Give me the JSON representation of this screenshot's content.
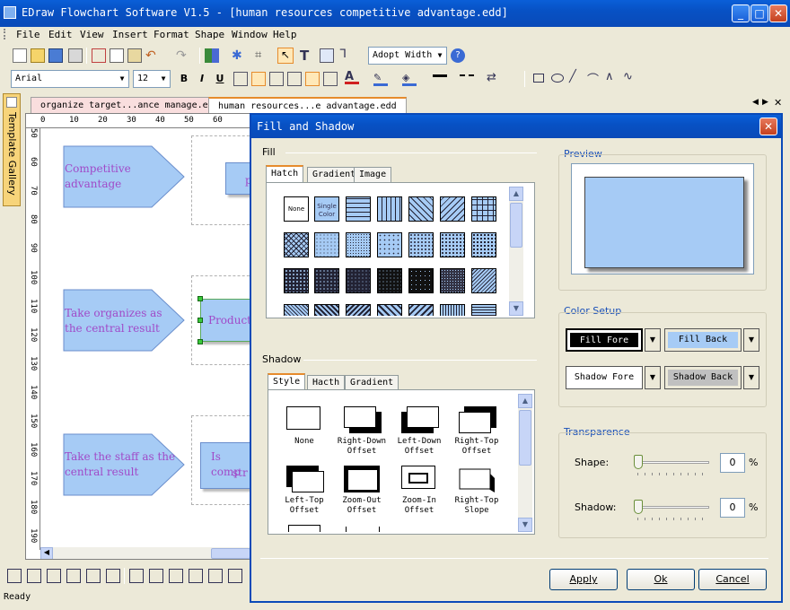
{
  "app": {
    "title": "EDraw Flowchart Software V1.5 - [human resources competitive advantage.edd]",
    "menu": [
      "File",
      "Edit",
      "View",
      "Insert",
      "Format",
      "Shape",
      "Window",
      "Help"
    ],
    "toolbar": {
      "adopt_width": "Adopt Width"
    },
    "format": {
      "font": "Arial",
      "size": "12",
      "bold": "B",
      "italic": "I",
      "underline": "U"
    },
    "gallery_tab": "Template Gallery",
    "doc_tabs": [
      "organize target...ance manage.edd",
      "human resources...e advantage.edd"
    ],
    "ruler_h": [
      "0",
      "10",
      "20",
      "30",
      "40",
      "50",
      "60"
    ],
    "ruler_v": [
      "50",
      "60",
      "70",
      "80",
      "90",
      "100",
      "110",
      "120",
      "130",
      "140",
      "150",
      "160",
      "170",
      "180",
      "190"
    ],
    "shapes": {
      "s1": "Competitive advantage",
      "s1b": "p",
      "s2": "Take organizes as the central result",
      "s2b": "Productio",
      "s3": "Take the staff as the central result",
      "s3b_line1": "Is comp",
      "s3b_line2": "str"
    },
    "status": "Ready"
  },
  "dialog": {
    "title": "Fill and Shadow",
    "fill": {
      "label": "Fill",
      "tabs": [
        "Hatch",
        "Gradient",
        "Image"
      ],
      "none_label": "None",
      "single_color_label": "Single Color"
    },
    "shadow": {
      "label": "Shadow",
      "tabs": [
        "Style",
        "Hacth",
        "Gradient"
      ],
      "items": [
        "None",
        "Right-Down Offset",
        "Left-Down Offset",
        "Right-Top Offset",
        "Left-Top Offset",
        "Zoom-Out Offset",
        "Zoom-In Offset",
        "Right-Top Slope"
      ]
    },
    "preview": {
      "label": "Preview",
      "fill_color": "#a6cbf5"
    },
    "color_setup": {
      "label": "Color Setup",
      "fill_fore": "Fill Fore",
      "fill_back": "Fill Back",
      "shadow_fore": "Shadow Fore",
      "shadow_back": "Shadow Back"
    },
    "transparence": {
      "label": "Transparence",
      "shape_label": "Shape:",
      "shape_value": "0",
      "shadow_label": "Shadow:",
      "shadow_value": "0",
      "unit": "%"
    },
    "buttons": {
      "apply": "Apply",
      "ok": "Ok",
      "cancel": "Cancel"
    }
  },
  "colors": {
    "accent": "#0a4ab8",
    "shape_fill": "#a6cbf5",
    "shape_text": "#a04ac8"
  }
}
